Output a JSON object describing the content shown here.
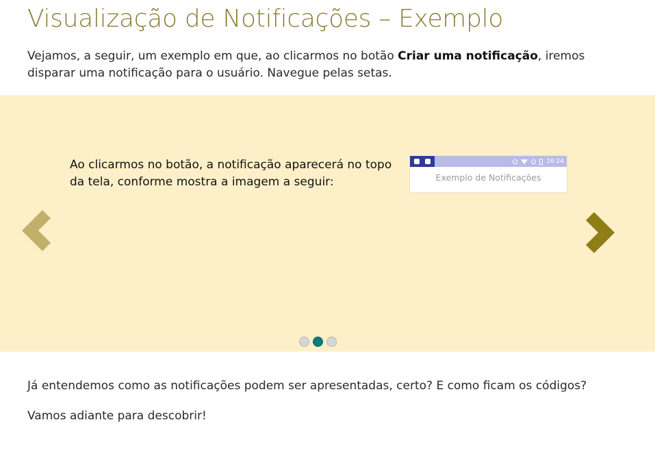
{
  "page": {
    "title": "Visualização de Notificações – Exemplo",
    "intro": {
      "before": "Vejamos, a seguir, um exemplo em que, ao clicarmos no botão ",
      "bold": "Criar uma notificação",
      "after": ", iremos disparar uma notificação para o usuário. Navegue pelas setas."
    }
  },
  "carousel": {
    "slide_text": "Ao clicarmos no botão, a notificação aparecerá no topo da tela, conforme mostra a imagem a seguir:",
    "screenshot": {
      "status_time": "16:24",
      "app_title": "Exemplo de Notificações"
    },
    "dots": [
      {
        "active": false
      },
      {
        "active": true
      },
      {
        "active": false
      }
    ],
    "colors": {
      "background": "#fdf0c8",
      "prev_arrow": "#c1b06a",
      "next_arrow": "#8f7d15",
      "active_dot": "#0c7c7a"
    }
  },
  "outro": {
    "paragraph1": "Já entendemos como as notificações podem ser apresentadas, certo? E como ficam os códigos?",
    "paragraph2": "Vamos adiante para descobrir!"
  }
}
